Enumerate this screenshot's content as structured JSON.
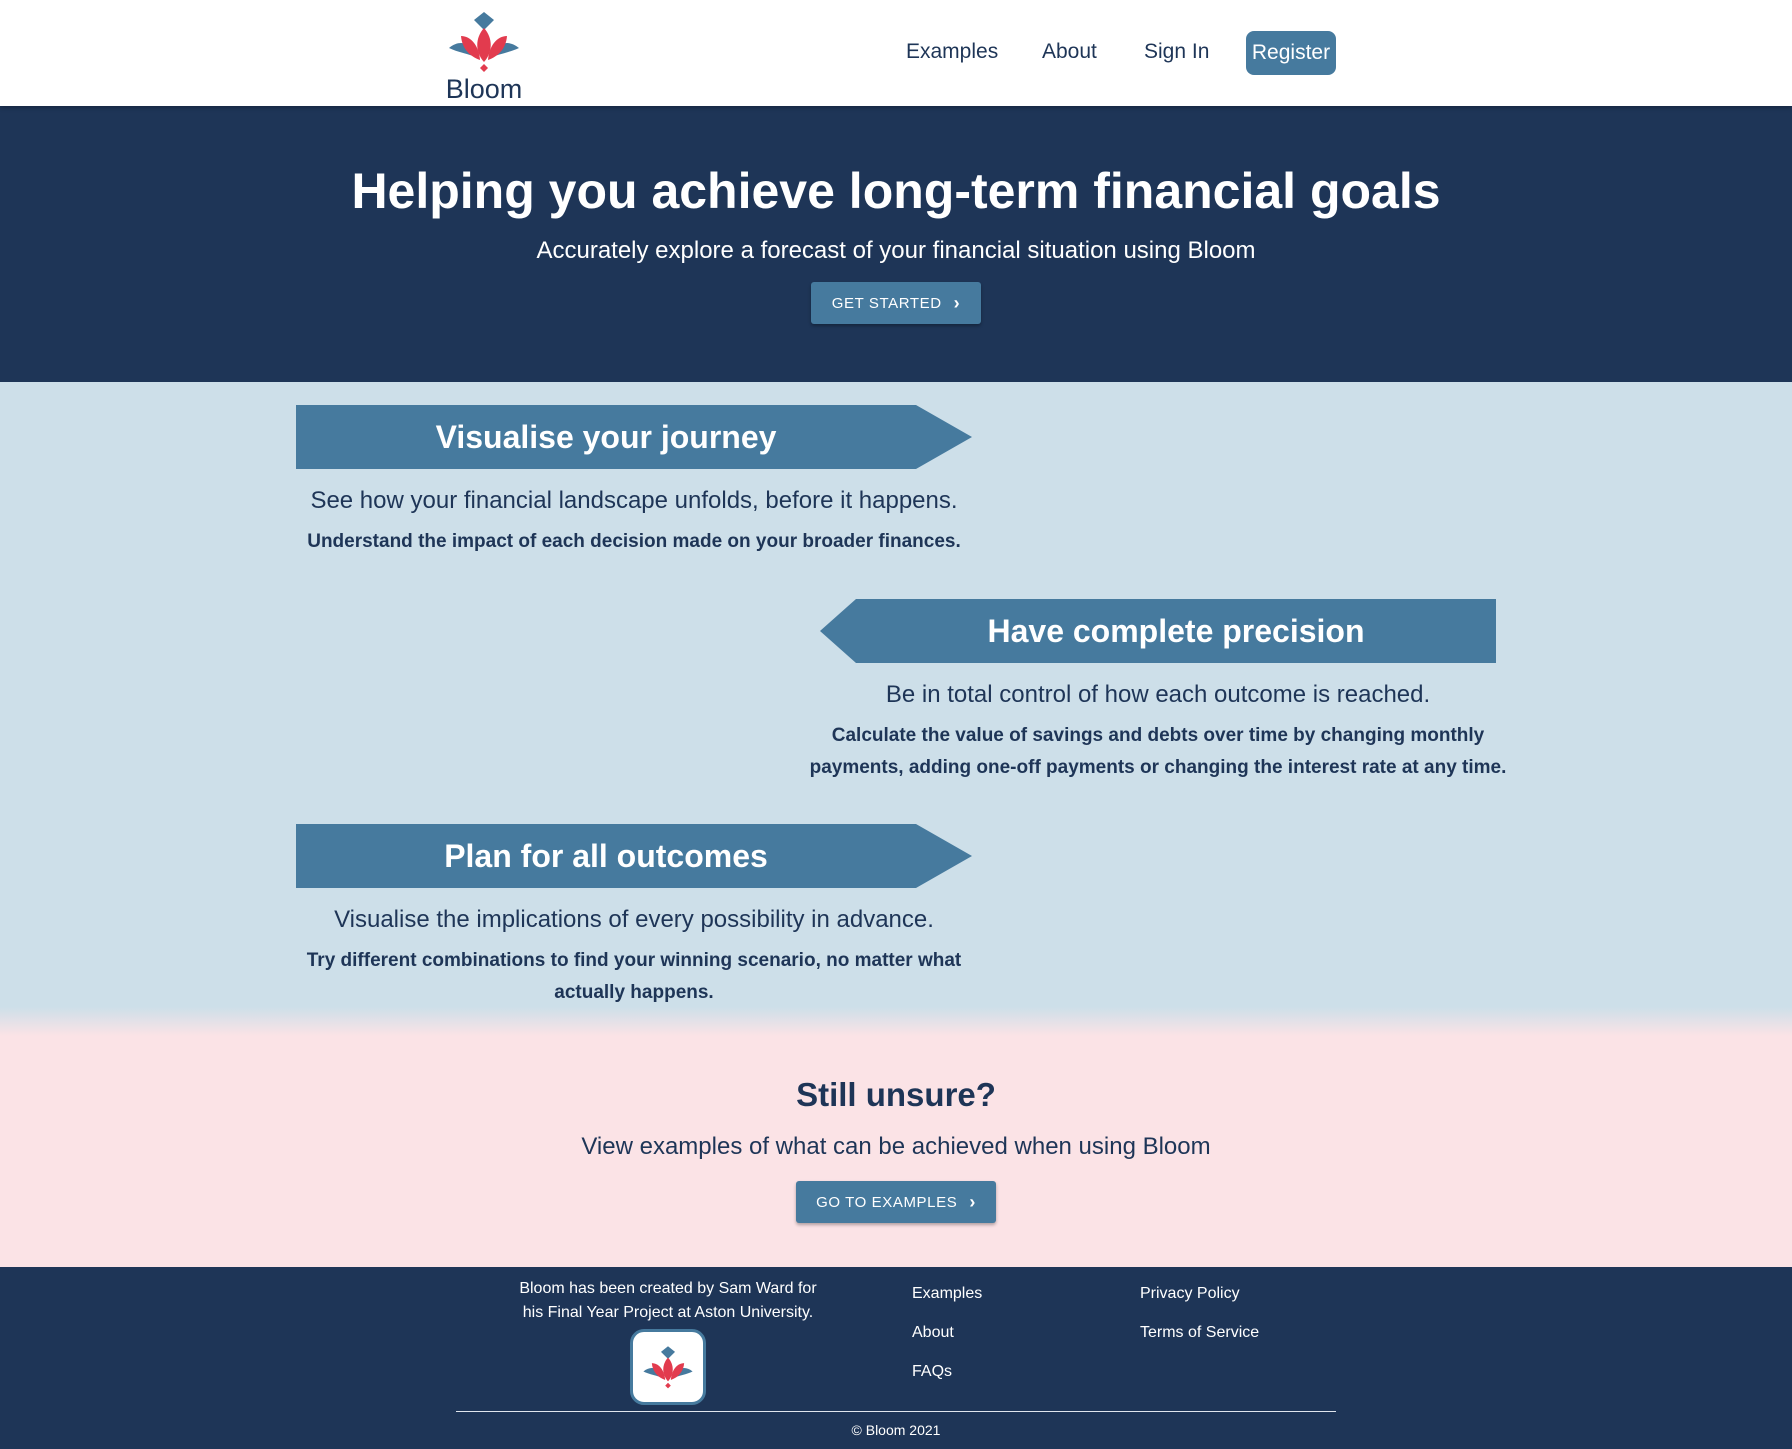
{
  "header": {
    "logo_text": "Bloom",
    "nav": {
      "examples": "Examples",
      "about": "About",
      "sign_in": "Sign In",
      "register": "Register"
    }
  },
  "hero": {
    "title": "Helping you achieve long-term financial goals",
    "subtitle": "Accurately explore a forecast of your financial situation using Bloom",
    "cta_label": "GET STARTED"
  },
  "features": [
    {
      "heading": "Visualise your journey",
      "lead": "See how your financial landscape unfolds, before it happens.",
      "detail": "Understand the impact of each decision made on your broader finances."
    },
    {
      "heading": "Have complete precision",
      "lead": "Be in total control of how each outcome is reached.",
      "detail": "Calculate the value of savings and debts over time by changing monthly payments, adding one-off payments or changing the interest rate at any time."
    },
    {
      "heading": "Plan for all outcomes",
      "lead": "Visualise the implications of every possibility in advance.",
      "detail": "Try different combinations to find your winning scenario, no matter what actually happens."
    }
  ],
  "unsure": {
    "title": "Still unsure?",
    "subtitle": "View examples of what can be achieved when using Bloom",
    "cta_label": "GO TO EXAMPLES"
  },
  "footer": {
    "credit": "Bloom has been created by Sam Ward for his Final Year Project at Aston University.",
    "links_col1": [
      "Examples",
      "About",
      "FAQs"
    ],
    "links_col2": [
      "Privacy Policy",
      "Terms of Service"
    ],
    "copyright": "© Bloom 2021"
  },
  "icons": {
    "logo": "lotus-logo-icon",
    "chevron": "chevron-right-icon"
  },
  "colors": {
    "navy": "#1e3557",
    "steel_blue": "#467a9e",
    "light_blue_bg": "#cddfe9",
    "pink_bg": "#fbe3e6",
    "lotus_red": "#e23b4e"
  }
}
